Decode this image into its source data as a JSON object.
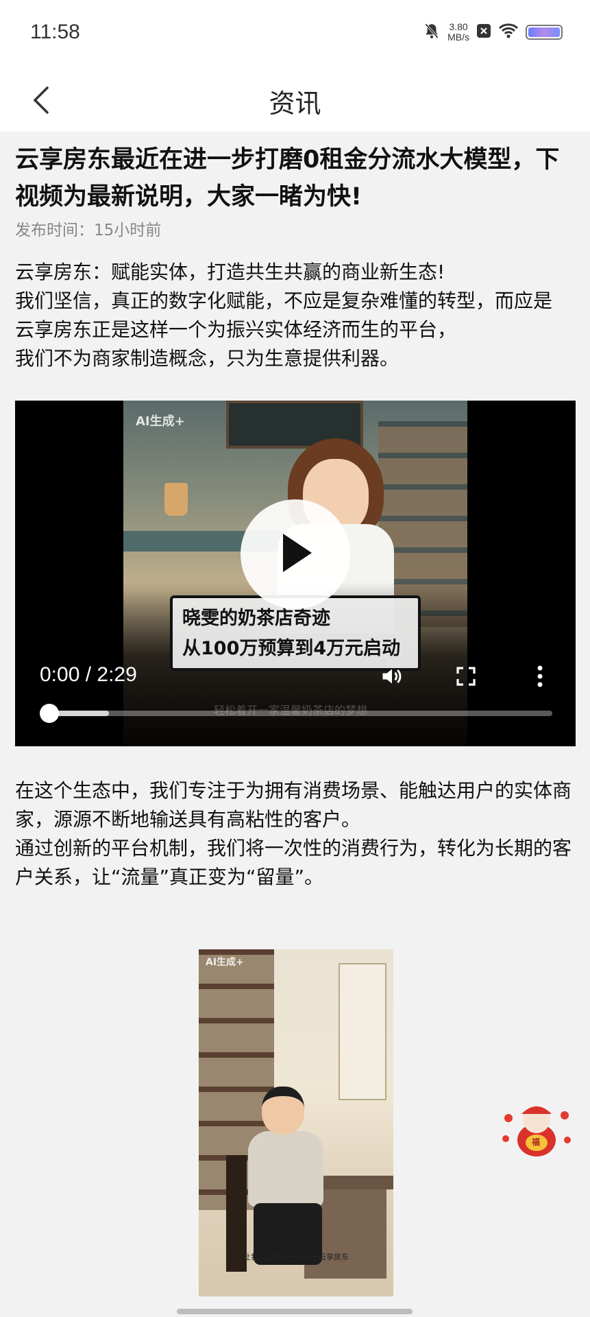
{
  "status_bar": {
    "time": "11:58",
    "net_speed_value": "3.80",
    "net_speed_unit": "MB/s",
    "icons": [
      "bell-muted-icon",
      "close-box-icon",
      "wifi-icon",
      "battery-icon"
    ]
  },
  "header": {
    "title": "资讯",
    "back_icon": "chevron-left-icon"
  },
  "article": {
    "title": "云享房东最近在进一步打磨0租金分流水大模型，下视频为最新说明，大家一睹为快!",
    "publish_label": "发布时间：15小时前",
    "intro_lines": [
      "云享房东：赋能实体，打造共生共赢的商业新生态!",
      "我们坚信，真正的数字化赋能，不应是复杂难懂的转型，而应是",
      "云享房东正是这样一个为振兴实体经济而生的平台，",
      "我们不为商家制造概念，只为生意提供利器。"
    ],
    "body_paragraphs": [
      "在这个生态中，我们专注于为拥有消费场景、能触达用户的实体商家，源源不断地输送具有高粘性的客户。",
      "通过创新的平台机制，我们将一次性的消费行为，转化为长期的客户关系，让“流量”真正变为“留量”。"
    ]
  },
  "video": {
    "watermark": "AI生成+",
    "caption_line1": "晓雯的奶茶店奇迹",
    "caption_line2": "从100万预算到4万元启动",
    "subtitle": "轻松着开一家温馨奶茶店的梦想",
    "time_display": "0:00 / 2:29",
    "buffered_fraction": 0.13,
    "played_fraction": 0.0,
    "controls": [
      "play-icon",
      "volume-icon",
      "fullscreen-icon",
      "more-vert-icon"
    ]
  },
  "image2": {
    "watermark": "AI生成+",
    "caption": "让我为您讲述一个关于云享房东"
  },
  "mascot": {
    "icon": "fortune-mascot-icon",
    "badge_text": "福"
  },
  "colors": {
    "background": "#f2f2f2",
    "surface": "#ffffff",
    "text_primary": "#111111",
    "text_secondary": "#888888"
  }
}
